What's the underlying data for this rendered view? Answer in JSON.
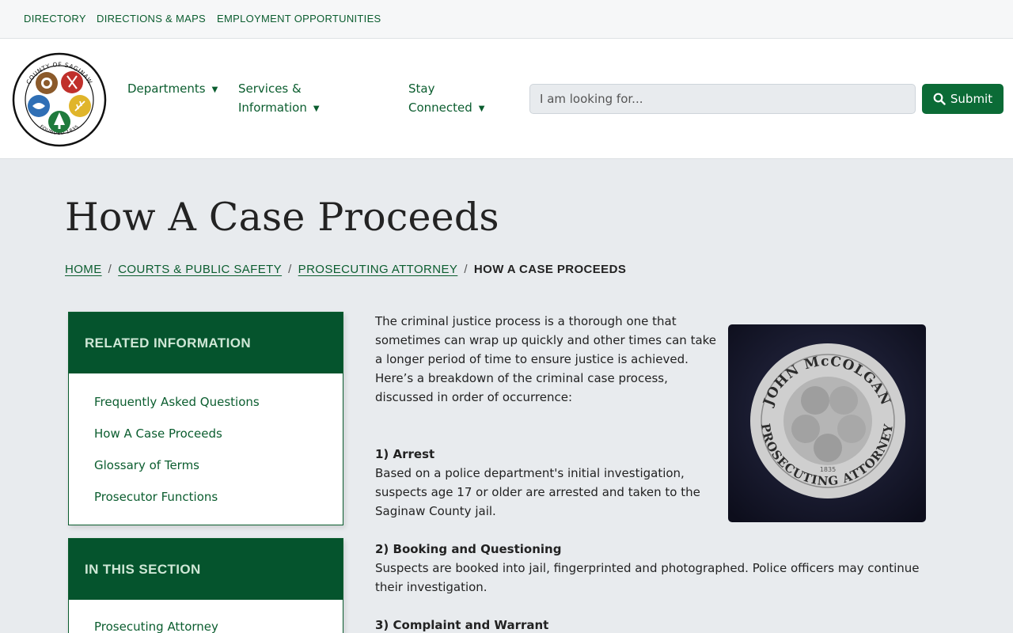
{
  "utility_nav": {
    "directory": "DIRECTORY",
    "directions": "DIRECTIONS & MAPS",
    "employment": "EMPLOYMENT OPPORTUNITIES"
  },
  "logo": {
    "top_text": "COUNTY OF SAGINAW",
    "bottom_text": "FOUNDED 1835"
  },
  "nav": {
    "departments": "Departments",
    "services_line1": "Services &",
    "services_line2": "Information",
    "stay_line1": "Stay",
    "stay_line2": "Connected"
  },
  "search": {
    "placeholder": "I am looking for...",
    "submit_label": "Submit"
  },
  "page": {
    "title": "How A Case Proceeds"
  },
  "breadcrumb": {
    "home": "HOME",
    "courts": "COURTS & PUBLIC SAFETY",
    "prosecuting": "PROSECUTING ATTORNEY",
    "current": "HOW A CASE PROCEEDS",
    "separator": "/"
  },
  "sidebar": {
    "related_heading": "RELATED INFORMATION",
    "related_items": [
      "Frequently Asked Questions",
      "How A Case Proceeds",
      "Glossary of Terms",
      "Prosecutor Functions"
    ],
    "section_heading": "IN THIS SECTION",
    "section_items": [
      "Prosecuting Attorney"
    ]
  },
  "main": {
    "intro": "The criminal justice process is a thorough one that sometimes can wrap up quickly and other times can take a longer period of time to ensure justice is achieved. Here’s a breakdown of the criminal case process, discussed in order of occurrence:",
    "steps": [
      {
        "title": "1) Arrest",
        "body": "Based on a police department's initial investigation, suspects age 17 or older are arrested and taken to the Saginaw County jail."
      },
      {
        "title": "2) Booking and Questioning",
        "body": "Suspects are booked into jail, fingerprinted and photographed. Police officers may continue their investigation."
      },
      {
        "title": "3) Complaint and Warrant",
        "body": ""
      }
    ]
  },
  "seal_photo": {
    "top_text": "JOHN McCOLGAN",
    "bottom_text": "PROSECUTING ATTORNEY",
    "year": "1835"
  },
  "colors": {
    "brand_green": "#0b5d2f",
    "header_green": "#05542d",
    "page_bg": "#e8ebee"
  }
}
